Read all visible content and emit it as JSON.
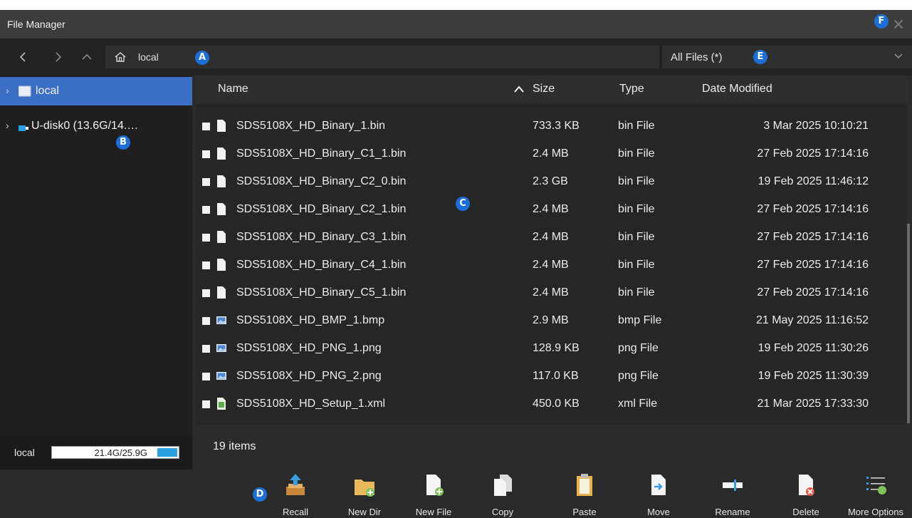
{
  "window": {
    "title": "File Manager"
  },
  "nav": {
    "back_icon": "chevron-left-icon",
    "forward_icon": "chevron-right-icon",
    "up_icon": "chevron-up-icon",
    "path": "local",
    "filter": "All Files (*)"
  },
  "sidebar": {
    "items": [
      {
        "label": "local",
        "selected": true,
        "icon": "drive-icon"
      },
      {
        "label": "U-disk0  (13.6G/14.…",
        "selected": false,
        "icon": "usb-icon"
      }
    ],
    "storage": {
      "label": "local",
      "usage": "21.4G/25.9G",
      "used_fraction": 0.83
    }
  },
  "filelist": {
    "columns": {
      "name": "Name",
      "size": "Size",
      "type": "Type",
      "date": "Date Modified"
    },
    "rows": [
      {
        "name": "SDS5108X_HD_Binary_1.bin",
        "size": "733.3 KB",
        "type": "bin File",
        "date": "3 Mar 2025 10:10:21",
        "icon": "file-icon"
      },
      {
        "name": "SDS5108X_HD_Binary_C1_1.bin",
        "size": "2.4 MB",
        "type": "bin File",
        "date": "27 Feb 2025 17:14:16",
        "icon": "file-icon"
      },
      {
        "name": "SDS5108X_HD_Binary_C2_0.bin",
        "size": "2.3 GB",
        "type": "bin File",
        "date": "19 Feb 2025 11:46:12",
        "icon": "file-icon"
      },
      {
        "name": "SDS5108X_HD_Binary_C2_1.bin",
        "size": "2.4 MB",
        "type": "bin File",
        "date": "27 Feb 2025 17:14:16",
        "icon": "file-icon"
      },
      {
        "name": "SDS5108X_HD_Binary_C3_1.bin",
        "size": "2.4 MB",
        "type": "bin File",
        "date": "27 Feb 2025 17:14:16",
        "icon": "file-icon"
      },
      {
        "name": "SDS5108X_HD_Binary_C4_1.bin",
        "size": "2.4 MB",
        "type": "bin File",
        "date": "27 Feb 2025 17:14:16",
        "icon": "file-icon"
      },
      {
        "name": "SDS5108X_HD_Binary_C5_1.bin",
        "size": "2.4 MB",
        "type": "bin File",
        "date": "27 Feb 2025 17:14:16",
        "icon": "file-icon"
      },
      {
        "name": "SDS5108X_HD_BMP_1.bmp",
        "size": "2.9 MB",
        "type": "bmp File",
        "date": "21 May 2025 11:16:52",
        "icon": "image-file-icon"
      },
      {
        "name": "SDS5108X_HD_PNG_1.png",
        "size": "128.9 KB",
        "type": "png File",
        "date": "19 Feb 2025 11:30:26",
        "icon": "image-file-icon"
      },
      {
        "name": "SDS5108X_HD_PNG_2.png",
        "size": "117.0 KB",
        "type": "png File",
        "date": "19 Feb 2025 11:30:39",
        "icon": "image-file-icon"
      },
      {
        "name": "SDS5108X_HD_Setup_1.xml",
        "size": "450.0 KB",
        "type": "xml File",
        "date": "21 Mar 2025 17:33:30",
        "icon": "xml-file-icon"
      }
    ]
  },
  "status": {
    "count": "19 items"
  },
  "toolbar": {
    "buttons": [
      {
        "label": "Recall",
        "icon": "recall-icon"
      },
      {
        "label": "New Dir",
        "icon": "new-folder-icon"
      },
      {
        "label": "New File",
        "icon": "new-file-icon"
      },
      {
        "label": "Copy",
        "icon": "copy-icon"
      },
      {
        "label": "Paste",
        "icon": "paste-icon"
      },
      {
        "label": "Move",
        "icon": "move-icon"
      },
      {
        "label": "Rename",
        "icon": "rename-icon"
      },
      {
        "label": "Delete",
        "icon": "delete-icon"
      },
      {
        "label": "More Options",
        "icon": "more-options-icon"
      }
    ]
  },
  "markers": {
    "a": "A",
    "b": "B",
    "c": "C",
    "d": "D",
    "e": "E",
    "f": "F"
  },
  "colors": {
    "accent": "#3a6fc5",
    "marker": "#1d6fd8",
    "storage_fill": "#2aa2e0",
    "background": "#2b2b2b"
  }
}
